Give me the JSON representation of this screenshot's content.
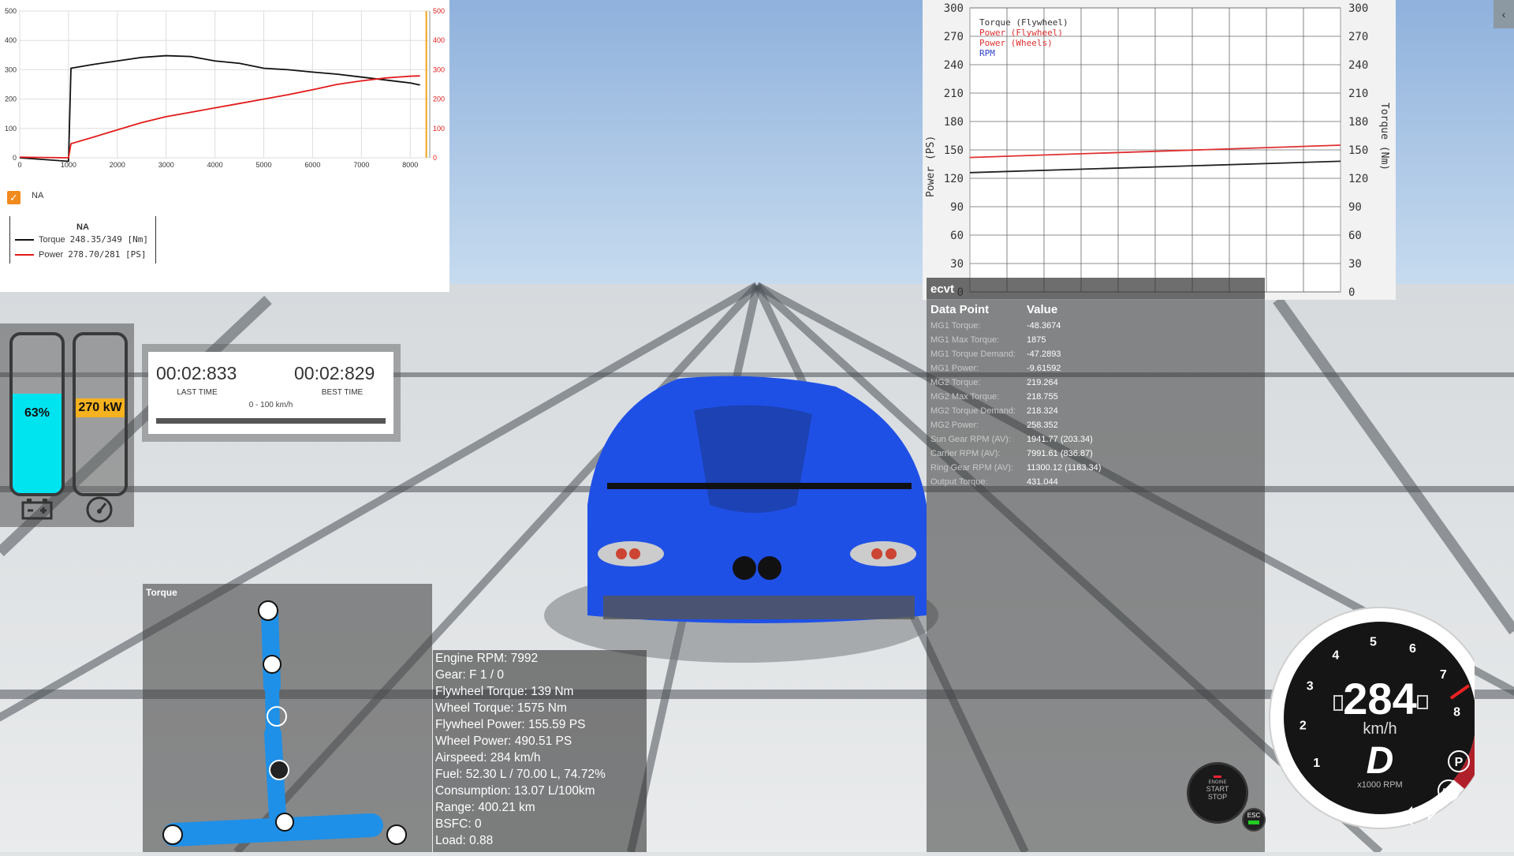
{
  "dyno": {
    "y_ticks_left": [
      "500",
      "400",
      "300",
      "200",
      "100",
      "0"
    ],
    "y_ticks_right": [
      "500",
      "400",
      "300",
      "200",
      "100",
      "0"
    ],
    "x_ticks": [
      "0",
      "1000",
      "2000",
      "3000",
      "4000",
      "5000",
      "6000",
      "7000",
      "8000"
    ],
    "checkbox_label": "NA",
    "legend_title": "NA",
    "legend_torque_label": "Torque",
    "legend_torque_value": "248.35/349 [Nm]",
    "legend_power_label": "Power",
    "legend_power_value": "278.70/281 [PS]",
    "colors": {
      "torque": "#111111",
      "power": "#e31a1a",
      "cursor": "#f2a21c"
    }
  },
  "pt_graph": {
    "legend": [
      {
        "label": "Torque (Flywheel)",
        "color": "#333333"
      },
      {
        "label": "Power (Flywheel)",
        "color": "#e03030"
      },
      {
        "label": "Power (Wheels)",
        "color": "#e03030"
      },
      {
        "label": "RPM",
        "color": "#3344cc"
      }
    ],
    "y_ticks": [
      "300",
      "270",
      "240",
      "210",
      "180",
      "150",
      "120",
      "90",
      "60",
      "30",
      "0"
    ],
    "left_axis_label": "Power (PS)",
    "right_axis_label": "Torque (Nm)"
  },
  "chart_data": [
    {
      "type": "line",
      "x": [
        0,
        1000,
        1050,
        1500,
        2000,
        2500,
        3000,
        3500,
        4000,
        4500,
        5000,
        5500,
        6000,
        6500,
        7000,
        7500,
        8000,
        8200
      ],
      "series": [
        {
          "name": "Torque",
          "values": [
            0,
            -12,
            305,
            318,
            330,
            342,
            348,
            345,
            330,
            322,
            305,
            300,
            292,
            285,
            275,
            265,
            255,
            248
          ]
        },
        {
          "name": "Power",
          "values": [
            2,
            0,
            48,
            70,
            95,
            120,
            140,
            155,
            170,
            185,
            200,
            215,
            232,
            250,
            262,
            272,
            278,
            279
          ]
        }
      ],
      "xlim": [
        0,
        8400
      ],
      "ylim": [
        0,
        500
      ],
      "grid": true
    },
    {
      "type": "line",
      "series": [
        {
          "name": "Power (Flywheel)",
          "values": [
            142,
            155
          ]
        },
        {
          "name": "Torque (Flywheel)",
          "values": [
            126,
            138
          ]
        }
      ],
      "ylim": [
        0,
        300
      ],
      "ylabel": "Power (PS)",
      "y2label": "Torque (Nm)",
      "grid": true
    }
  ],
  "ecvt": {
    "title": "ecvt",
    "col_key": "Data Point",
    "col_value": "Value",
    "rows": [
      {
        "k": "MG1 Torque:",
        "v": "-48.3674"
      },
      {
        "k": "MG1 Max Torque:",
        "v": "1875"
      },
      {
        "k": "MG1 Torque Demand:",
        "v": "-47.2893"
      },
      {
        "k": "MG1 Power:",
        "v": "-9.61592"
      },
      {
        "k": "MG2 Torque:",
        "v": "219.264"
      },
      {
        "k": "MG2 Max Torque:",
        "v": "218.755"
      },
      {
        "k": "MG2 Torque Demand:",
        "v": "218.324"
      },
      {
        "k": "MG2 Power:",
        "v": "258.352"
      },
      {
        "k": "Sun Gear RPM (AV):",
        "v": "1941.77 (203.34)"
      },
      {
        "k": "Carrier RPM (AV):",
        "v": "7991.61 (836.87)"
      },
      {
        "k": "Ring Gear RPM (AV):",
        "v": "11300.12 (1183.34)"
      },
      {
        "k": "Output Torque:",
        "v": "431.044"
      }
    ]
  },
  "gauges": {
    "battery_label": "63%",
    "battery_level": 0.63,
    "battery_color": "#00e4f0",
    "power_label": "270 kW",
    "power_color": "#f5b21e"
  },
  "timer": {
    "last_time": "00:02:833",
    "last_caption": "LAST TIME",
    "best_time": "00:02:829",
    "best_caption": "BEST TIME",
    "mode": "0 - 100 km/h"
  },
  "torque_panel": {
    "title": "Torque",
    "color": "#1e90e8"
  },
  "engine_info": [
    "Engine RPM: 7992",
    "Gear: F 1 / 0",
    "Flywheel Torque: 139 Nm",
    "Wheel Torque: 1575 Nm",
    "Flywheel Power: 155.59 PS",
    "Wheel Power: 490.51 PS",
    "Airspeed: 284 km/h",
    "Fuel: 52.30 L / 70.00 L, 74.72%",
    "Consumption: 13.07 L/100km",
    "Range: 400.21 km",
    "BSFC: 0",
    "Load: 0.88"
  ],
  "startstop": {
    "line1": "ENGINE",
    "line2": "START",
    "line3": "STOP"
  },
  "esc_label": "ESC",
  "speedo": {
    "speed": "284",
    "unit": "km/h",
    "gear": "D",
    "rpm_unit": "x1000 RPM",
    "ticks": [
      "1",
      "2",
      "3",
      "4",
      "5",
      "6",
      "7",
      "8"
    ],
    "park_label": "P",
    "abs_label": "ABS",
    "redline_color": "#b0202a"
  }
}
